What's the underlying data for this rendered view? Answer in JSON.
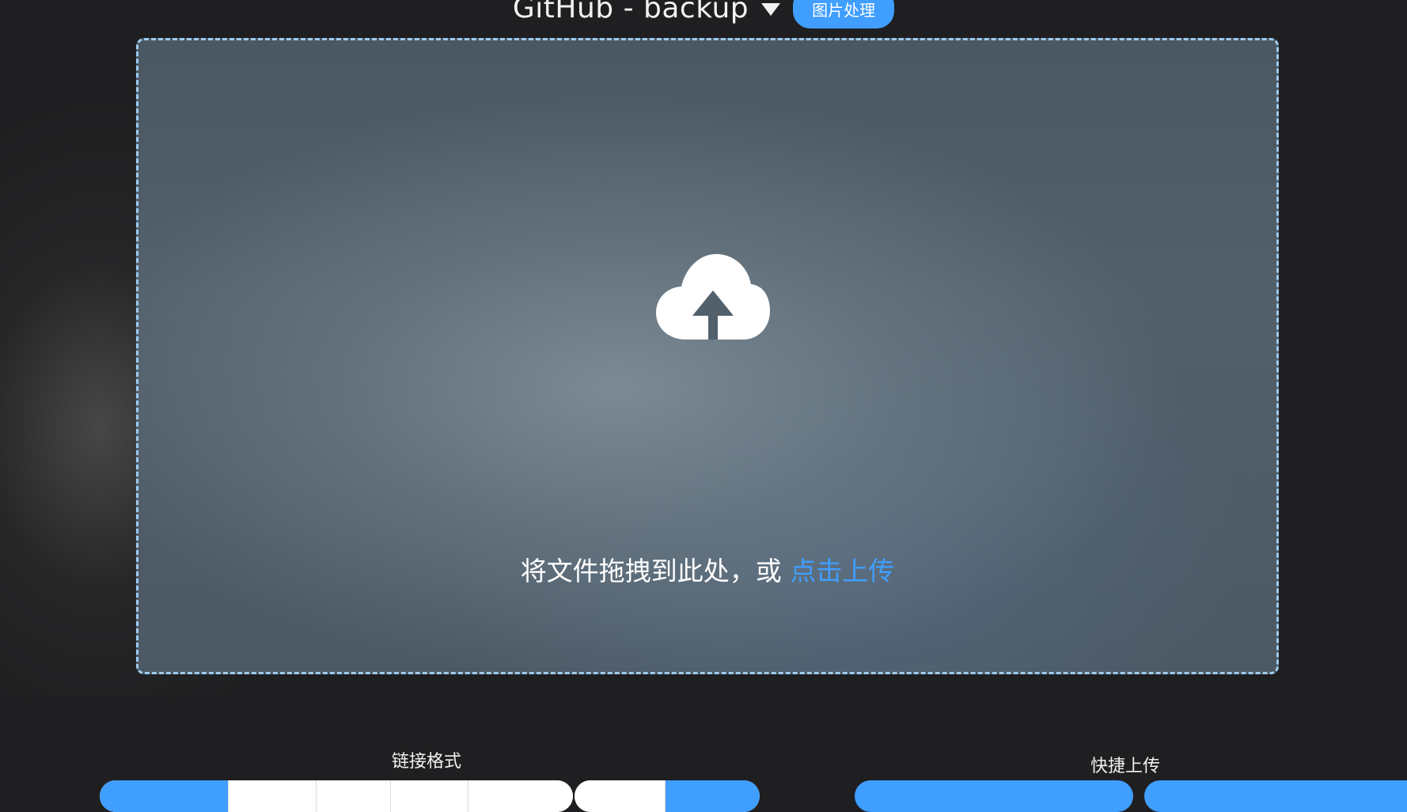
{
  "header": {
    "picbed_title": "GitHub - backup",
    "image_process_label": "图片处理"
  },
  "dropzone": {
    "icon": "cloud-upload-icon",
    "hint_text": "将文件拖拽到此处，或 ",
    "link_text": "点击上传"
  },
  "link_format": {
    "label": "链接格式",
    "options": [
      "",
      "",
      "",
      "",
      ""
    ],
    "selected_index": 0
  },
  "custom_link": {
    "options": [
      "",
      ""
    ]
  },
  "quick_upload": {
    "label": "快捷上传",
    "buttons": [
      "",
      ""
    ]
  },
  "colors": {
    "accent": "#409eff",
    "background": "#1f1f21",
    "dropzone_border": "#9fcbef"
  }
}
